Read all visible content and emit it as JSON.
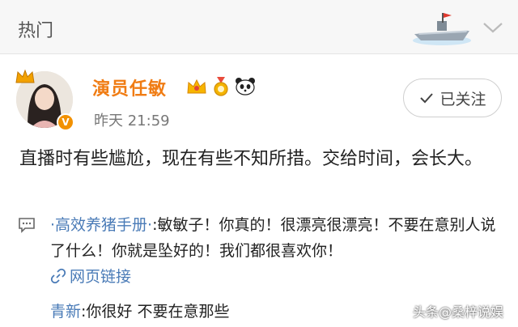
{
  "header": {
    "title": "热门",
    "ship_icon": "ship-icon",
    "chevron_icon": "chevron-down-icon"
  },
  "post": {
    "username": "演员任敏",
    "timestamp": "昨天 21:59",
    "follow_label": "已关注",
    "text": "直播时有些尴尬，现在有些不知所措。交给时间，会长大。",
    "accent": "#f07c13",
    "verified_color": "#f29100"
  },
  "comments": [
    {
      "user": "·高效养猪手册·",
      "text": ":敏敏子！你真的！很漂亮很漂亮！不要在意别人说了什么！你就是坠好的！我们都很喜欢你！"
    },
    {
      "user": "青新",
      "text": ":你很好 不要在意那些"
    }
  ],
  "link": {
    "label": "网页链接"
  },
  "watermark": "头条@桑梓说娱",
  "link_color": "#4a7bb7"
}
